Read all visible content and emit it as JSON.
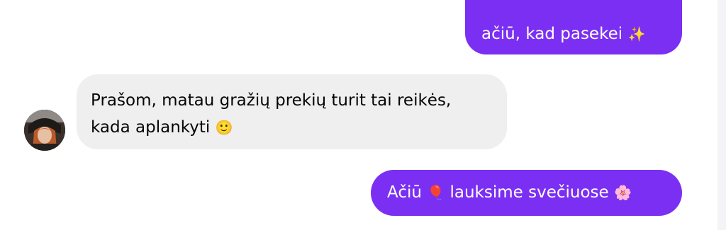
{
  "messages": [
    {
      "direction": "sent",
      "text": "ačiū, kad pasekei",
      "emoji": "✨"
    },
    {
      "direction": "received",
      "line1": "Prašom, matau gražių prekių turit tai reikės,",
      "line2": "kada aplankyti",
      "emoji": "🙂"
    },
    {
      "direction": "sent",
      "text_a": "Ačiū",
      "emoji_a": "🎈",
      "text_b": "lauksime svečiuose",
      "emoji_b": "🌸"
    }
  ],
  "colors": {
    "sent_bubble": "#7b2ff2",
    "received_bubble": "#efefef"
  }
}
